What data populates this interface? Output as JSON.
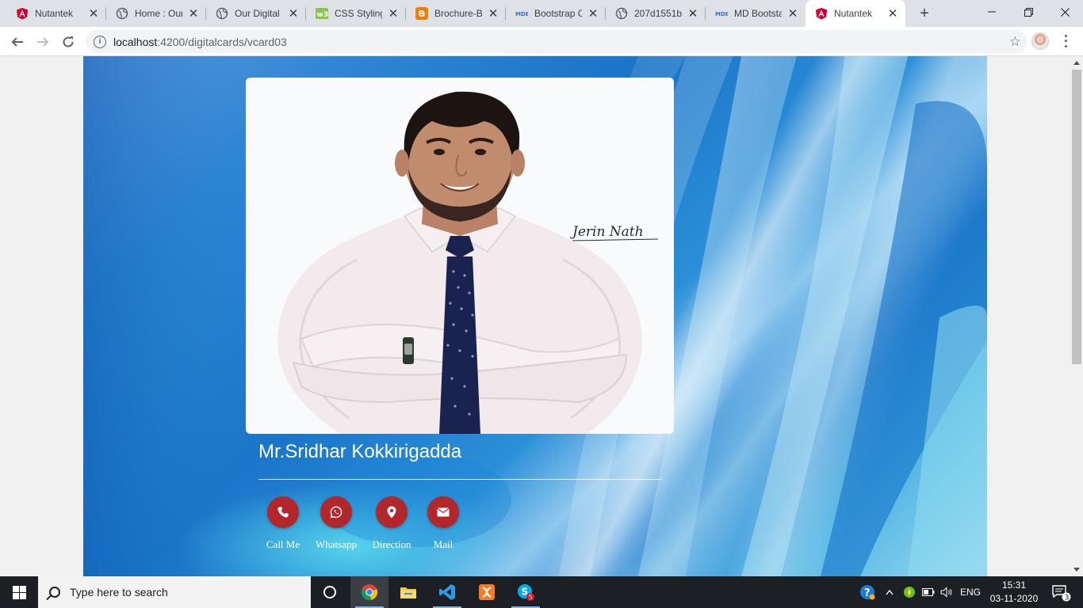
{
  "browser": {
    "tabs": [
      {
        "title": "Nutantek",
        "icon": "angular-icon",
        "active": false
      },
      {
        "title": "Home : Our",
        "icon": "globe-icon",
        "active": false
      },
      {
        "title": "Our Digital",
        "icon": "globe-icon",
        "active": false
      },
      {
        "title": "CSS Styling",
        "icon": "w3schools-icon",
        "active": false
      },
      {
        "title": "Brochure-B",
        "icon": "blogger-icon",
        "active": false
      },
      {
        "title": "Bootstrap C",
        "icon": "mdb-icon",
        "active": false
      },
      {
        "title": "207d1551b",
        "icon": "globe-icon",
        "active": false
      },
      {
        "title": "MD Bootsta",
        "icon": "mdb-icon",
        "active": false
      },
      {
        "title": "Nutantek",
        "icon": "angular-icon",
        "active": true
      }
    ],
    "new_tab_label": "+",
    "address": {
      "host": "localhost",
      "path": ":4200/digitalcards/vcard03"
    }
  },
  "page": {
    "name": "Mr.Sridhar Kokkirigadda",
    "signature": "Jerin Nath",
    "actions": [
      {
        "label": "Call Me",
        "icon": "phone-icon"
      },
      {
        "label": "Whatsapp",
        "icon": "whatsapp-icon"
      },
      {
        "label": "Direction",
        "icon": "map-pin-icon"
      },
      {
        "label": "Mail",
        "icon": "envelope-icon"
      }
    ],
    "accent_color": "#b3262a"
  },
  "taskbar": {
    "search_placeholder": "Type here to search",
    "language": "ENG",
    "time": "15:31",
    "date": "03-11-2020",
    "notification_count": "3",
    "skype_badge": "5"
  }
}
